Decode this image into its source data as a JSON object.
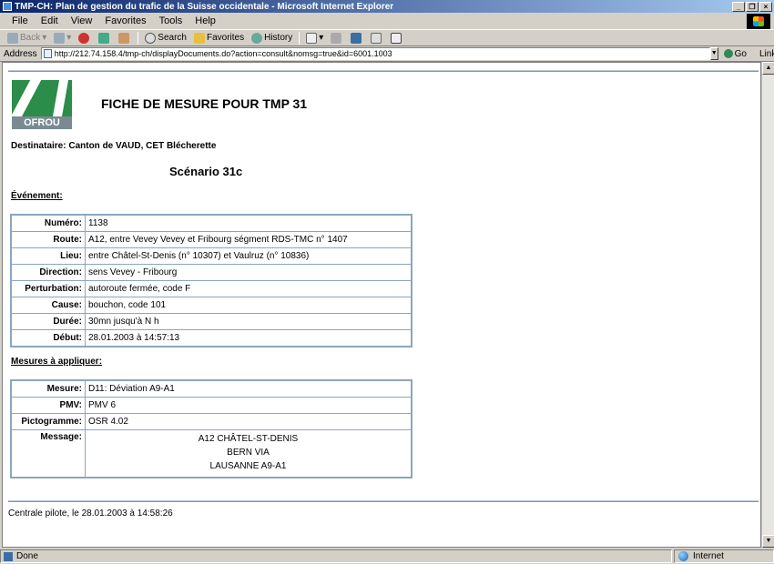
{
  "window": {
    "title": "TMP-CH: Plan de gestion du trafic de la Suisse occidentale - Microsoft Internet Explorer",
    "controls": [
      "_",
      "❐",
      "×"
    ]
  },
  "menu": [
    "File",
    "Edit",
    "View",
    "Favorites",
    "Tools",
    "Help"
  ],
  "toolbar": {
    "back": "Back",
    "search": "Search",
    "favorites": "Favorites",
    "history": "History"
  },
  "address": {
    "label": "Address",
    "url": "http://212.74.158.4/tmp-ch/displayDocuments.do?action=consult&nomsg=true&id=6001.1003",
    "go": "Go",
    "links": "Links"
  },
  "page": {
    "logo_text": "OFROU",
    "title": "FICHE DE MESURE POUR TMP 31",
    "recipient": "Destinataire: Canton de VAUD, CET Blécherette",
    "scenario": "Scénario 31c",
    "event_heading": "Événement:",
    "event_rows": [
      {
        "label": "Numéro:",
        "value": "1138"
      },
      {
        "label": "Route:",
        "value": "A12, entre Vevey Vevey et Fribourg ségment RDS-TMC n° 1407"
      },
      {
        "label": "Lieu:",
        "value": "entre Châtel-St-Denis (n° 10307) et Vaulruz (n° 10836)"
      },
      {
        "label": "Direction:",
        "value": "sens Vevey - Fribourg"
      },
      {
        "label": "Perturbation:",
        "value": "autoroute fermée, code F"
      },
      {
        "label": "Cause:",
        "value": "bouchon, code 101"
      },
      {
        "label": "Durée:",
        "value": "30mn jusqu'à N h"
      },
      {
        "label": "Début:",
        "value": "28.01.2003 à 14:57:13"
      }
    ],
    "measures_heading": "Mesures à appliquer:",
    "measure_rows": [
      {
        "label": "Mesure:",
        "value": "D11: Déviation A9-A1"
      },
      {
        "label": "PMV:",
        "value": "PMV 6"
      },
      {
        "label": "Pictogramme:",
        "value": "OSR 4.02"
      }
    ],
    "message_label": "Message:",
    "message_lines": [
      "A12 CHÂTEL-ST-DENIS",
      "BERN VIA",
      "LAUSANNE A9-A1"
    ],
    "footer": "Centrale pilote, le 28.01.2003 à 14:58:26"
  },
  "status": {
    "text": "Done",
    "zone": "Internet"
  }
}
